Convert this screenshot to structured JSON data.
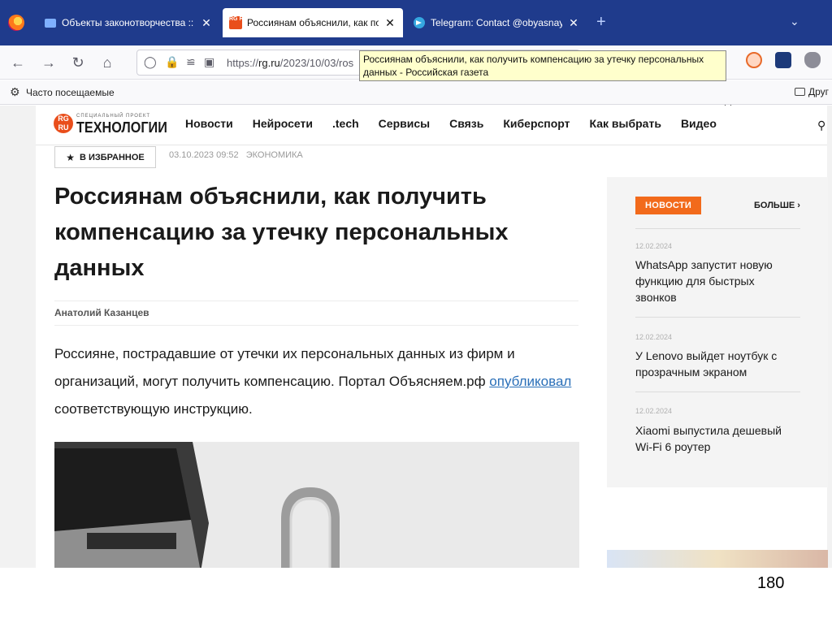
{
  "browser": {
    "tabs": [
      {
        "label": "Объекты законотворчества :: C",
        "close": "✕"
      },
      {
        "label": "Россиянам объяснили, как получ",
        "close": "✕",
        "favicon": "RG RU"
      },
      {
        "label": "Telegram: Contact @obyasnayem",
        "close": "✕"
      }
    ],
    "new_tab": "+",
    "url": {
      "prefix": "https://",
      "host": "rg.ru",
      "path": "/2023/10/03/ros"
    },
    "tooltip": "Россиянам объяснили, как получить компенсацию за утечку персональных данных - Российская газета",
    "bookmarks": {
      "most_visited": "Часто посещаемые",
      "other": "Друг"
    }
  },
  "site": {
    "logo_mark": "RG RU",
    "logo_sub": "СПЕЦИАЛЬНЫЙ ПРОЕКТ",
    "logo_main": "ТЕХНОЛОГИИ",
    "nav": [
      "Новости",
      "Нейросети",
      ".tech",
      "Сервисы",
      "Связь",
      "Киберспорт",
      "Как выбрать",
      "Видео"
    ]
  },
  "article": {
    "favorite_label": "В ИЗБРАННОЕ",
    "datetime": "03.10.2023 09:52",
    "category": "ЭКОНОМИКА",
    "title": "Россиянам объяснили, как получить компенсацию за утечку персональных данных",
    "author": "Анатолий Казанцев",
    "lead_part1": "Россияне, пострадавшие от утечки их персональных данных из фирм и организаций, могут получить компенсацию. Портал Объясняем.рф ",
    "lead_link": "опубликовал",
    "lead_part2": " соответствующую инструкцию."
  },
  "sidebar": {
    "tag": "НОВОСТИ",
    "more": "БОЛЬШЕ",
    "items": [
      {
        "date": "12.02.2024",
        "title": "WhatsApp запустит новую функцию для быстрых звонков"
      },
      {
        "date": "12.02.2024",
        "title": "У Lenovo выйдет ноутбук с прозрачным экраном"
      },
      {
        "date": "12.02.2024",
        "title": "Xiaomi выпустила дешевый Wi-Fi 6 роутер"
      }
    ]
  },
  "slide": {
    "page_number": "180"
  }
}
